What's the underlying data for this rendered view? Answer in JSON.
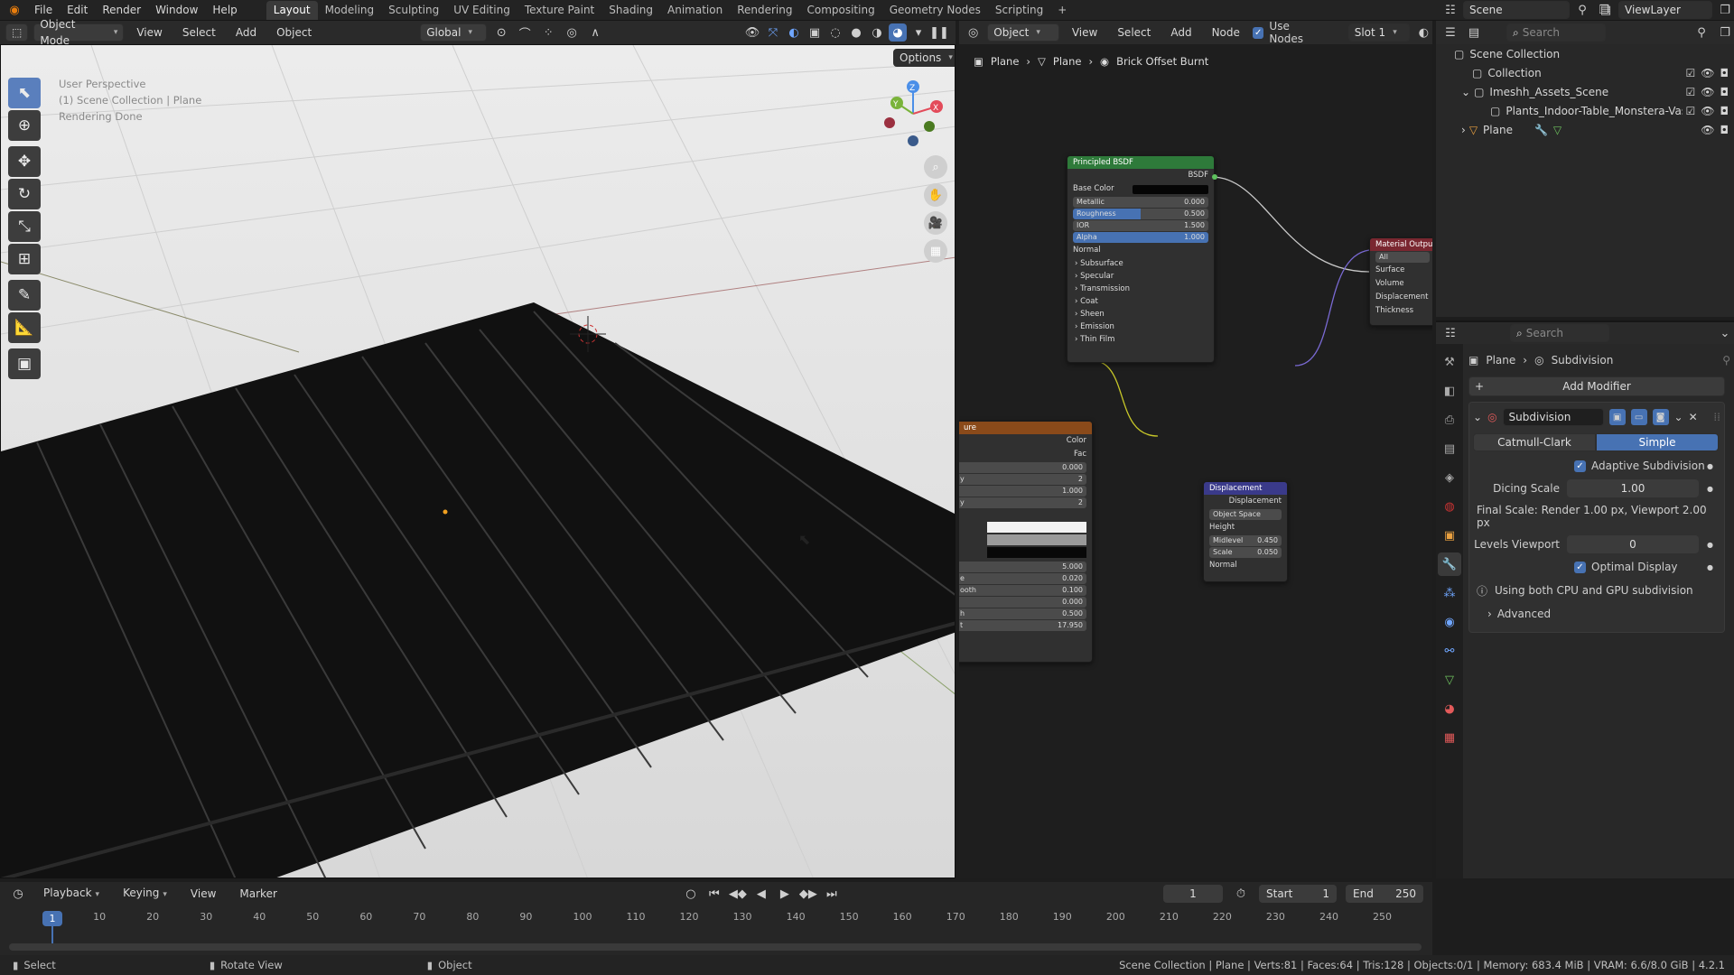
{
  "topbar": {
    "menus": [
      "File",
      "Edit",
      "Render",
      "Window",
      "Help"
    ],
    "workspaces": [
      "Layout",
      "Modeling",
      "Sculpting",
      "UV Editing",
      "Texture Paint",
      "Shading",
      "Animation",
      "Rendering",
      "Compositing",
      "Geometry Nodes",
      "Scripting"
    ],
    "active_workspace": "Layout",
    "add_tab": "+",
    "scene": "Scene",
    "view_layer": "ViewLayer"
  },
  "viewport": {
    "mode": "Object Mode",
    "menus": [
      "View",
      "Select",
      "Add",
      "Object"
    ],
    "orientation": "Global",
    "options": "Options",
    "overlay_lines": [
      "User Perspective",
      "(1) Scene Collection | Plane",
      "Rendering Done"
    ],
    "gizmo": {
      "x": "X",
      "y": "Y",
      "z": "Z"
    }
  },
  "node_editor": {
    "type": "Object",
    "menus": [
      "View",
      "Select",
      "Add",
      "Node"
    ],
    "use_nodes": "Use Nodes",
    "slot": "Slot 1",
    "breadcrumb": [
      "Plane",
      "Plane",
      "Brick Offset Burnt"
    ],
    "principled": {
      "title": "Principled BSDF",
      "output": "BSDF",
      "base_color": "Base Color",
      "fields": [
        {
          "label": "Metallic",
          "value": "0.000",
          "blue": false
        },
        {
          "label": "Roughness",
          "value": "0.500",
          "blue": true
        },
        {
          "label": "IOR",
          "value": "1.500",
          "blue": false
        },
        {
          "label": "Alpha",
          "value": "1.000",
          "blue": true
        }
      ],
      "normal": "Normal",
      "panels": [
        "Subsurface",
        "Specular",
        "Transmission",
        "Coat",
        "Sheen",
        "Emission",
        "Thin Film"
      ]
    },
    "material_output": {
      "title": "Material Outpu",
      "target": "All",
      "inputs": [
        "Surface",
        "Volume",
        "Displacement",
        "Thickness"
      ]
    },
    "brick": {
      "title": "ure",
      "outputs": [
        "Color",
        "Fac"
      ],
      "fields": [
        {
          "label": "",
          "value": "0.000"
        },
        {
          "label": "y",
          "value": "2"
        },
        {
          "label": "",
          "value": "1.000"
        },
        {
          "label": "y",
          "value": "2"
        }
      ],
      "fields2": [
        {
          "label": "",
          "value": "5.000"
        },
        {
          "label": "e",
          "value": "0.020"
        },
        {
          "label": "ooth",
          "value": "0.100"
        },
        {
          "label": "",
          "value": "0.000"
        },
        {
          "label": "h",
          "value": "0.500"
        },
        {
          "label": "t",
          "value": "17.950"
        }
      ]
    },
    "displacement": {
      "title": "Displacement",
      "output": "Displacement",
      "space": "Object Space",
      "height": "Height",
      "fields": [
        {
          "label": "Midlevel",
          "value": "0.450"
        },
        {
          "label": "Scale",
          "value": "0.050"
        }
      ],
      "normal": "Normal"
    }
  },
  "outliner": {
    "search_placeholder": "Search",
    "items": [
      {
        "label": "Scene Collection"
      },
      {
        "label": "Collection"
      },
      {
        "label": "Imeshh_Assets_Scene"
      },
      {
        "label": "Plants_Indoor-Table_Monstera-Vase"
      },
      {
        "label": "Plane"
      }
    ]
  },
  "properties": {
    "search_placeholder": "Search",
    "breadcrumb": [
      "Plane",
      "Subdivision"
    ],
    "add_modifier": "Add Modifier",
    "modifier_name": "Subdivision",
    "mode_tabs": [
      "Catmull-Clark",
      "Simple"
    ],
    "active_mode": "Simple",
    "adaptive": "Adaptive Subdivision",
    "dicing_label": "Dicing Scale",
    "dicing_value": "1.00",
    "final_scale": "Final Scale: Render 1.00 px, Viewport 2.00 px",
    "levels_label": "Levels Viewport",
    "levels_value": "0",
    "optimal": "Optimal Display",
    "info": "Using both CPU and GPU subdivision",
    "advanced": "Advanced"
  },
  "timeline": {
    "menus": [
      "Playback",
      "Keying",
      "View",
      "Marker"
    ],
    "current_frame": "1",
    "start_label": "Start",
    "start": "1",
    "end_label": "End",
    "end": "250",
    "ticks": [
      "1",
      "10",
      "20",
      "30",
      "40",
      "50",
      "60",
      "70",
      "80",
      "90",
      "100",
      "110",
      "120",
      "130",
      "140",
      "150",
      "160",
      "170",
      "180",
      "190",
      "200",
      "210",
      "220",
      "230",
      "240",
      "250"
    ]
  },
  "status": {
    "select": "Select",
    "rotate": "Rotate View",
    "object": "Object",
    "stats": "Scene Collection | Plane | Verts:81 | Faces:64 | Tris:128 | Objects:0/1 | Memory: 683.4 MiB | VRAM: 6.6/8.0 GiB | 4.2.1"
  }
}
